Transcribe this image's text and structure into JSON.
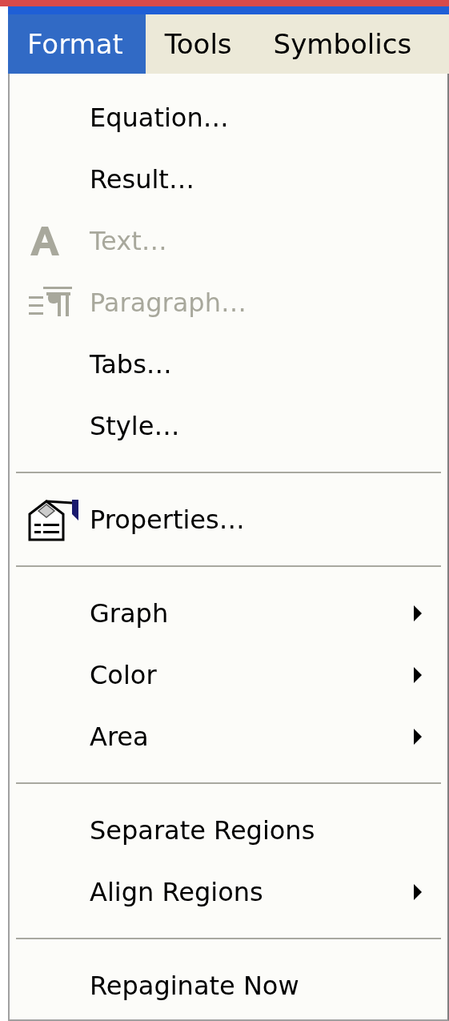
{
  "menubar": [
    {
      "label": "Format",
      "selected": true
    },
    {
      "label": "Tools",
      "selected": false
    },
    {
      "label": "Symbolics",
      "selected": false
    }
  ],
  "menu": {
    "items": [
      {
        "kind": "command",
        "label": "Equation…",
        "disabled": false
      },
      {
        "kind": "command",
        "label": "Result…",
        "disabled": false
      },
      {
        "kind": "command",
        "label": "Text…",
        "disabled": true
      },
      {
        "kind": "command",
        "label": "Paragraph…",
        "disabled": true
      },
      {
        "kind": "command",
        "label": "Tabs…",
        "disabled": false
      },
      {
        "kind": "command",
        "label": "Style…",
        "disabled": false
      },
      {
        "kind": "separator"
      },
      {
        "kind": "command",
        "label": "Properties…",
        "disabled": false
      },
      {
        "kind": "separator"
      },
      {
        "kind": "submenu",
        "label": "Graph",
        "disabled": false
      },
      {
        "kind": "submenu",
        "label": "Color",
        "disabled": false
      },
      {
        "kind": "submenu",
        "label": "Area",
        "disabled": false
      },
      {
        "kind": "separator"
      },
      {
        "kind": "command",
        "label": "Separate Regions",
        "disabled": false
      },
      {
        "kind": "submenu",
        "label": "Align Regions",
        "disabled": false
      },
      {
        "kind": "separator"
      },
      {
        "kind": "command",
        "label": "Repaginate Now",
        "disabled": false
      }
    ]
  }
}
